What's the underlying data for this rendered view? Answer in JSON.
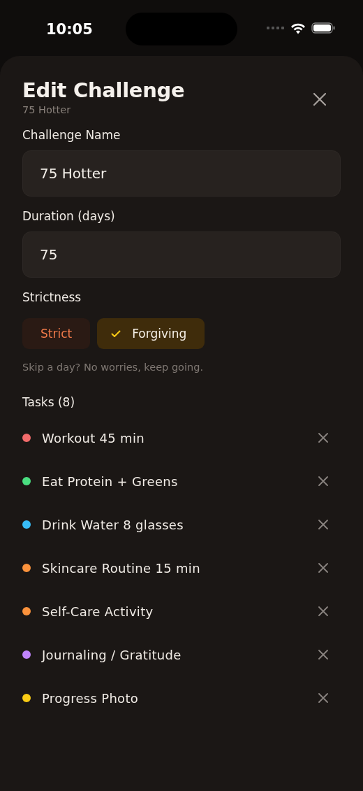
{
  "status_bar": {
    "time": "10:05"
  },
  "header": {
    "title": "Edit Challenge",
    "subtitle": "75 Hotter"
  },
  "fields": [
    {
      "label": "Challenge Name",
      "value": "75 Hotter"
    },
    {
      "label": "Duration (days)",
      "value": "75"
    }
  ],
  "strictness": {
    "label": "Strictness",
    "options": [
      {
        "label": "Strict",
        "selected": false,
        "kind": "strict"
      },
      {
        "label": "Forgiving",
        "selected": true,
        "kind": "forgiving"
      }
    ],
    "hint": "Skip a day? No worries, keep going."
  },
  "tasks": {
    "label": "Tasks (8)",
    "items": [
      {
        "name": "Workout 45 min",
        "color": "#f26b6b"
      },
      {
        "name": "Eat Protein + Greens",
        "color": "#4ade80"
      },
      {
        "name": "Drink Water 8 glasses",
        "color": "#38bdf8"
      },
      {
        "name": "Skincare Routine 15 min",
        "color": "#fb923c"
      },
      {
        "name": "Self-Care Activity",
        "color": "#fb923c"
      },
      {
        "name": "Journaling / Gratitude",
        "color": "#c084fc"
      },
      {
        "name": "Progress Photo",
        "color": "#facc15"
      }
    ]
  }
}
